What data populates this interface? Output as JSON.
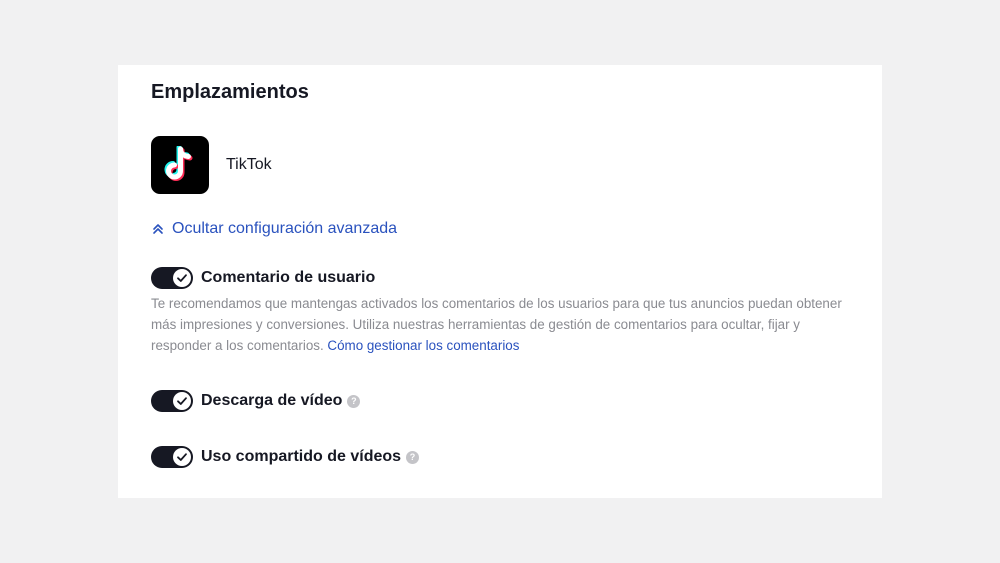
{
  "section": {
    "title": "Emplazamientos"
  },
  "placement": {
    "name": "TikTok",
    "icon": "tiktok-logo"
  },
  "advanced": {
    "label": "Ocultar configuración avanzada",
    "icon": "double-chevron-up-icon"
  },
  "settings": {
    "user_comment": {
      "label": "Comentario de usuario",
      "enabled": true,
      "description": "Te recomendamos que mantengas activados los comentarios de los usuarios para que tus anuncios puedan obtener más impresiones y conversiones. Utiliza nuestras herramientas de gestión de comentarios para ocultar, fijar y responder a los comentarios.",
      "link_text": "Cómo gestionar los comentarios"
    },
    "video_download": {
      "label": "Descarga de vídeo",
      "enabled": true,
      "help": "?"
    },
    "video_sharing": {
      "label": "Uso compartido de vídeos",
      "enabled": true,
      "help": "?"
    }
  },
  "colors": {
    "link": "#2a52be",
    "toggle_on": "#161823",
    "muted_text": "#8a8b91"
  }
}
